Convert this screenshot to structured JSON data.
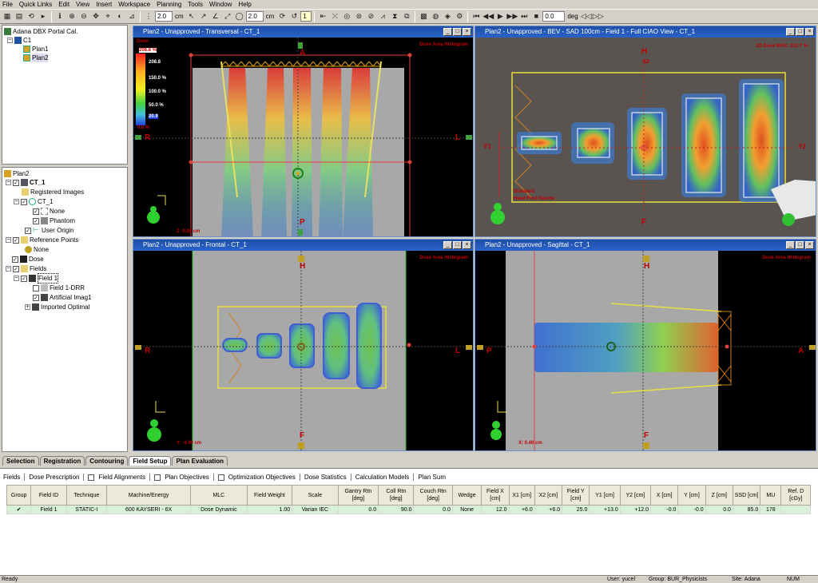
{
  "menu": [
    "File",
    "Quick Links",
    "Edit",
    "View",
    "Insert",
    "Workspace",
    "Planning",
    "Tools",
    "Window",
    "Help"
  ],
  "toolbar": {
    "zoom1": "2.0",
    "unit1": "cm",
    "zoom2": "2.0",
    "unit2": "cm",
    "num": "1",
    "angle": "0.0",
    "angle_unit": "deg"
  },
  "tree_top": {
    "root": "Adana DBX Portal Cal.",
    "course": "C1",
    "plans": [
      "Plan1",
      "Plan2"
    ]
  },
  "tree_main": {
    "plan": "Plan2",
    "ct": "CT_1",
    "registered": "Registered Images",
    "ct_sub": "CT_1",
    "none1": "None",
    "phantom": "Phantom",
    "user_origin": "User Origin",
    "ref_points": "Reference Points",
    "none2": "None",
    "dose": "Dose",
    "fields": "Fields",
    "field1": "Field 1",
    "field_drr": "Field 1-DRR",
    "artificial": "Artificial Imag1",
    "imported": "Imported Optimal"
  },
  "views": {
    "transversal": {
      "title": "Plan2  -  Unapproved  -  Transversal  -  CT_1",
      "dvh": "Dose Area Histogram",
      "dose_label": "Dose",
      "max": "208.8 %",
      "l0": "208.8",
      "l1": "150.0 %",
      "l2": "100.0 %",
      "l3": "50.0 %",
      "min": "20.9",
      "zero": "0.0 %",
      "coord": "Z: 0.00 cm",
      "A": "A",
      "P": "P",
      "R": "R",
      "L": "L"
    },
    "bev": {
      "title": "Plan2  -  Unapproved  -  BEV  -  SAD 100cm  -  Field 1  -  Full CIAO View  -  CT_1",
      "max": "3D Dose MAX: 210.7 %",
      "H": "H",
      "X2": "X2",
      "F": "F",
      "Y1": "Y1",
      "Y2": "Y2",
      "standard": "Standard",
      "orientation": "Head First-Supine"
    },
    "frontal": {
      "title": "Plan2  -  Unapproved  -  Frontal  -  CT_1",
      "dvh": "Dose Area Histogram",
      "coord": "Y: -4.00 cm",
      "H": "H",
      "F": "F",
      "R": "R",
      "L": "L"
    },
    "sagittal": {
      "title": "Plan2  -  Unapproved  -  Sagittal  -  CT_1",
      "dvh": "Dose Area Histogram",
      "coord": "X: 0.40 cm",
      "H": "H",
      "F": "F",
      "P": "P",
      "A": "A"
    }
  },
  "workspace_tabs": [
    "Selection",
    "Registration",
    "Contouring",
    "Field Setup",
    "Plan Evaluation"
  ],
  "bottom_tabs": [
    "Fields",
    "Dose Prescription",
    "Field Alignments",
    "Plan Objectives",
    "Optimization Objectives",
    "Dose Statistics",
    "Calculation Models",
    "Plan Sum"
  ],
  "table": {
    "headers": [
      "Group",
      "Field ID",
      "Technique",
      "Machine/Energy",
      "MLC",
      "Field Weight",
      "Scale",
      "Gantry Rtn [deg]",
      "Coll Rtn [deg]",
      "Couch Rtn [deg]",
      "Wedge",
      "Field X [cm]",
      "X1 [cm]",
      "X2 [cm]",
      "Field Y [cm]",
      "Y1 [cm]",
      "Y2 [cm]",
      "X [cm]",
      "Y [cm]",
      "Z [cm]",
      "SSD [cm]",
      "MU",
      "Ref. D [cGy]"
    ],
    "row": [
      "✔",
      "Field 1",
      "STATIC-I",
      "600 KAYSERI - 6X",
      "Dose Dynamic",
      "1.00",
      "Varian IEC",
      "0.0",
      "90.0",
      "0.0",
      "None",
      "12.0",
      "+6.0",
      "+6.0",
      "25.0",
      "+13.0",
      "+12.0",
      "-0.0",
      "-0.0",
      "0.0",
      "85.0",
      "178",
      ""
    ]
  },
  "status": {
    "ready": "Ready",
    "user": "User: yucel",
    "group": "Group: BUR_Physicists",
    "site": "Site: Adana",
    "num": "NUM"
  }
}
